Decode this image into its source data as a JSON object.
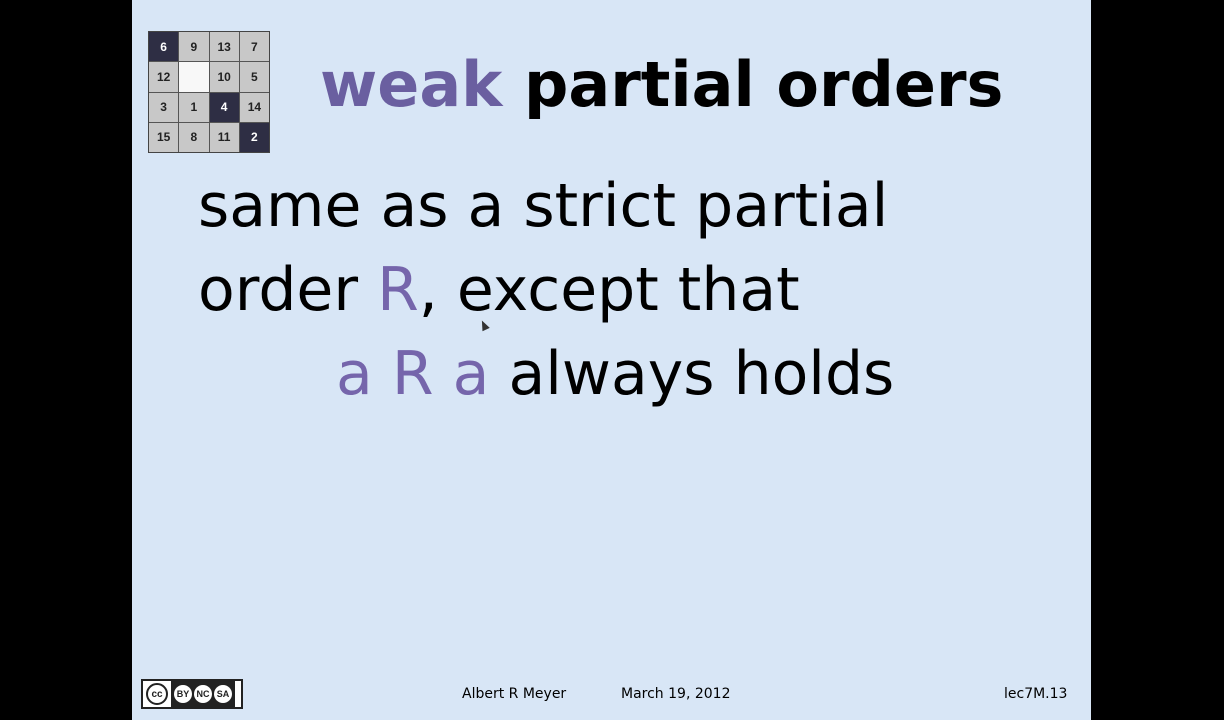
{
  "puzzle": {
    "tiles": [
      {
        "label": "6",
        "dark": true
      },
      {
        "label": "9",
        "dark": false
      },
      {
        "label": "13",
        "dark": false
      },
      {
        "label": "7",
        "dark": false
      },
      {
        "label": "12",
        "dark": false
      },
      {
        "label": "",
        "dark": false
      },
      {
        "label": "10",
        "dark": false
      },
      {
        "label": "5",
        "dark": false
      },
      {
        "label": "3",
        "dark": false
      },
      {
        "label": "1",
        "dark": false
      },
      {
        "label": "4",
        "dark": true
      },
      {
        "label": "14",
        "dark": false
      },
      {
        "label": "15",
        "dark": false
      },
      {
        "label": "8",
        "dark": false
      },
      {
        "label": "11",
        "dark": false
      },
      {
        "label": "2",
        "dark": true
      }
    ]
  },
  "title": {
    "accent": "weak",
    "rest": "partial orders"
  },
  "body": {
    "line1": "same as a strict partial",
    "line2_start": "order ",
    "line2_accent": "R",
    "line2_end": ", except that",
    "line3_accent": "a R a",
    "line3_end": " always holds"
  },
  "footer": {
    "author": "Albert R Meyer",
    "date": "March 19, 2012",
    "slide_id": "lec7M.13",
    "license": {
      "cc": "cc",
      "by": "BY",
      "nc": "NC",
      "sa": "SA"
    }
  },
  "colors": {
    "background": "#d8e6f6",
    "accent": "#6a5fa0"
  }
}
